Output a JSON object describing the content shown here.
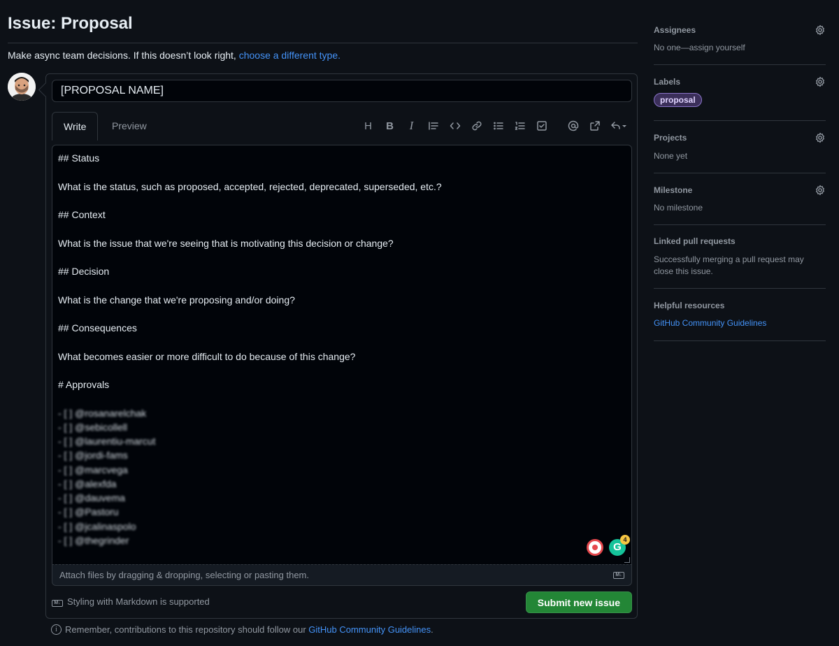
{
  "page": {
    "title": "Issue: Proposal",
    "subtitle_text": "Make async team decisions. If this doesn’t look right, ",
    "subtitle_link": "choose a different type."
  },
  "form": {
    "title_value": "[PROPOSAL NAME]",
    "tabs": [
      {
        "label": "Write",
        "active": true
      },
      {
        "label": "Preview",
        "active": false
      }
    ],
    "toolbar_icons": [
      "heading-icon",
      "bold-icon",
      "italic-icon",
      "quote-icon",
      "code-icon",
      "link-icon",
      "unordered-list-icon",
      "ordered-list-icon",
      "task-list-icon",
      "mention-icon",
      "cross-reference-icon",
      "reply-icon"
    ],
    "body_lines": [
      "## Status",
      "",
      "What is the status, such as proposed, accepted, rejected, deprecated, superseded, etc.?",
      "",
      "## Context",
      "",
      "What is the issue that we're seeing that is motivating this decision or change?",
      "",
      "## Decision",
      "",
      "What is the change that we're proposing and/or doing?",
      "",
      "## Consequences",
      "",
      "What becomes easier or more difficult to do because of this change?",
      "",
      "# Approvals",
      ""
    ],
    "approval_lines": [
      "- [ ] @rosanarelchak",
      "- [ ] @sebicollell",
      "- [ ] @laurentiu-marcut",
      "- [ ] @jordi-fams",
      "- [ ] @marcvega",
      "- [ ] @alexfda",
      "- [ ] @dauvema",
      "- [ ] @Pastoru",
      "- [ ] @jcalinaspolo",
      "- [ ] @thegrinder"
    ],
    "grammarly_badge": "4",
    "grammarly_letter": "G",
    "attach_text": "Attach files by dragging & dropping, selecting or pasting them.",
    "markdown_badge": "M↓",
    "markdown_support": "Styling with Markdown is supported",
    "submit_label": "Submit new issue"
  },
  "footer": {
    "note_text": "Remember, contributions to this repository should follow our ",
    "note_link": "GitHub Community Guidelines",
    "note_end": "."
  },
  "sidebar": {
    "assignees": {
      "heading": "Assignees",
      "value": "No one—assign yourself"
    },
    "labels": {
      "heading": "Labels",
      "pill": "proposal"
    },
    "projects": {
      "heading": "Projects",
      "value": "None yet"
    },
    "milestone": {
      "heading": "Milestone",
      "value": "No milestone"
    },
    "linked_prs": {
      "heading": "Linked pull requests",
      "value": "Successfully merging a pull request may close this issue."
    },
    "helpful": {
      "heading": "Helpful resources",
      "link": "GitHub Community Guidelines"
    }
  },
  "colors": {
    "background": "#0d1117",
    "border": "#30363d",
    "link": "#4493f8",
    "submit": "#238636",
    "label_pill": "#8a74c9"
  }
}
